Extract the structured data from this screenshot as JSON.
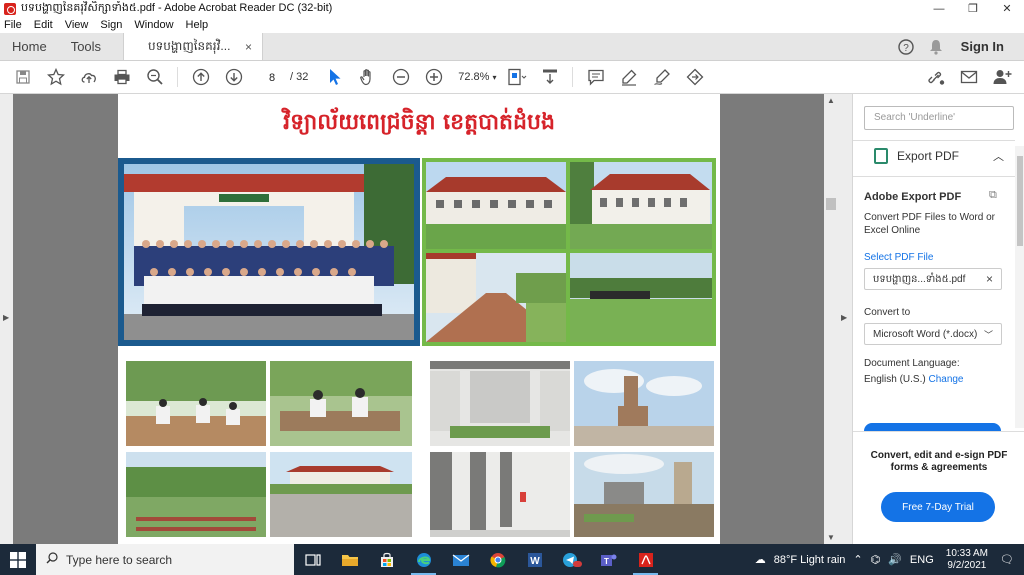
{
  "window": {
    "title": "បទបង្ហាញនៃគរុវិសិក្សាទាំង៥.pdf - Adobe Acrobat Reader DC (32-bit)",
    "minimize": "—",
    "restore": "❐",
    "close": "✕"
  },
  "menu": [
    "File",
    "Edit",
    "View",
    "Sign",
    "Window",
    "Help"
  ],
  "tabs": {
    "home": "Home",
    "tools": "Tools",
    "document": "បទបង្ហាញនៃគរុវិ...",
    "close": "×",
    "help_icon": "?",
    "bell_icon": "🔔",
    "sign_in": "Sign In"
  },
  "toolbar": {
    "current_page": "8",
    "total_pages": "/ 32",
    "zoom": "72.8%"
  },
  "document": {
    "heading": "វិទ្យាល័យពេជ្រចិន្តា ខេត្តបាត់ដំបង"
  },
  "right_panel": {
    "search_placeholder": "Search 'Underline'",
    "export_title": "Export PDF",
    "section_title": "Adobe Export PDF",
    "description": "Convert PDF Files to Word or Excel Online",
    "select_file_label": "Select PDF File",
    "selected_file": "បទបង្ហាញន...ទាំង៥.pdf",
    "convert_to_label": "Convert to",
    "convert_to_value": "Microsoft Word (*.docx)",
    "doc_language_label": "Document Language:",
    "doc_language_value": "English (U.S.)",
    "change_link": "Change",
    "promo_text": "Convert, edit and e-sign PDF forms & agreements",
    "trial_button": "Free 7-Day Trial"
  },
  "taskbar": {
    "search_placeholder": "Type here to search",
    "weather": "88°F  Light rain",
    "language": "ENG",
    "time": "10:33 AM",
    "date": "9/2/2021"
  }
}
